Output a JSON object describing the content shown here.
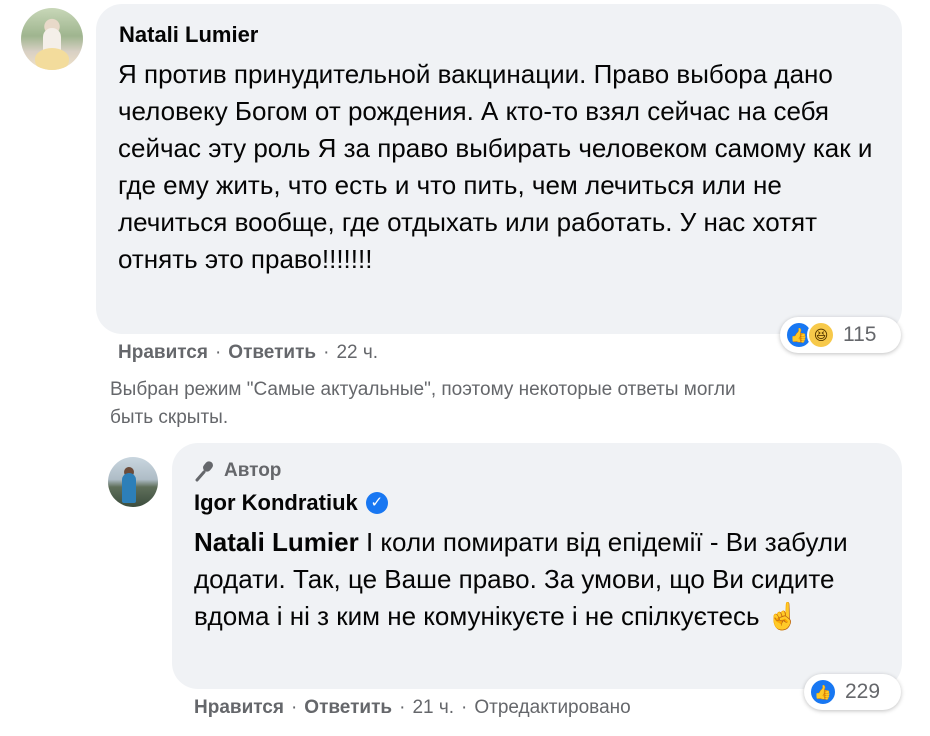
{
  "comment": {
    "author": "Natali Lumier",
    "text": "Я против принудительной вакцинации. Право выбора дано человеку Богом от рождения. А кто-то взял сейчас на себя сейчас эту роль Я за право выбирать человеком самому как и где ему жить, что есть и что пить, чем лечиться или не лечиться вообще, где отдыхать или работать. У нас хотят отнять это право!!!!!!!",
    "reactions": {
      "icons": [
        "like-icon",
        "haha-icon"
      ],
      "count": "115"
    },
    "actions": {
      "like": "Нравится",
      "reply": "Ответить",
      "time": "22 ч."
    }
  },
  "notice": "Выбран режим \"Самые актуальные\", поэтому некоторые ответы могли\nбыть скрыты.",
  "reply": {
    "badge": "Автор",
    "author": "Igor Kondratiuk",
    "mention": "Natali Lumier",
    "text": " І коли помирати від епідемії - Ви забули додати. Так, це Ваше право. За умови, що Ви сидите вдома і ні з ким не комунікуєте і не спілкуєтесь ☝️",
    "reactions": {
      "icons": [
        "like-icon"
      ],
      "count": "229"
    },
    "actions": {
      "like": "Нравится",
      "reply": "Ответить",
      "time": "21 ч.",
      "edited": "Отредактировано"
    }
  },
  "colors": {
    "bubble": "#f0f2f5",
    "secondary_text": "#65676b",
    "like_blue": "#1877f2",
    "haha_yellow": "#f7c94a"
  }
}
